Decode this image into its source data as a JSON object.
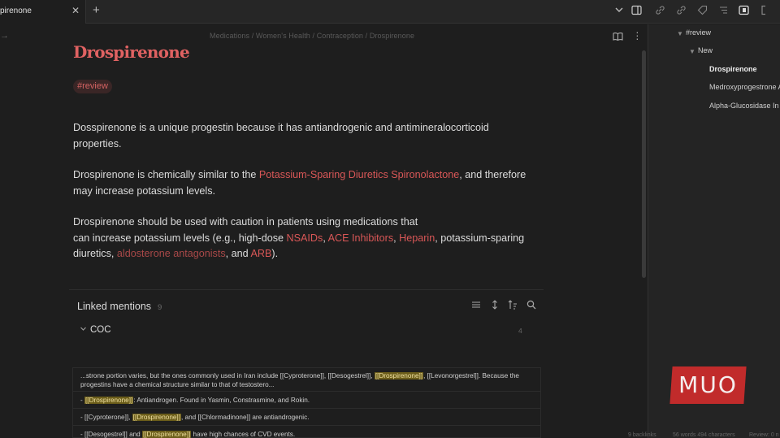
{
  "tab": {
    "title": "pirenone",
    "close": "✕",
    "new": "+"
  },
  "toolbar_icons": [
    "chevron-down-icon",
    "sidebar-toggle-icon",
    "link-icon",
    "link-icon",
    "tag-icon",
    "list-icon",
    "layout-icon",
    "bracket-icon"
  ],
  "breadcrumb": "Medications / Women's Health / Contraception / Drospirenone",
  "note": {
    "title": "Drospirenone",
    "tag": "#review",
    "p1": "Dosspirenone is a unique progestin because it has antiandrogenic and antimineralocorticoid properties.",
    "p2_start": "Drospirenone is chemically similar to the ",
    "p2_link": "Potassium-Sparing Diuretics Spironolactone",
    "p2_end": ", and therefore may increase potassium levels.",
    "p3_line1": "Drospirenone should be used with caution in patients using medications that",
    "p3_a": "can increase potassium levels (e.g., high-dose ",
    "p3_l1": "NSAIDs",
    "p3_c1": ", ",
    "p3_l2": "ACE Inhibitors",
    "p3_c2": ", ",
    "p3_l3": "Heparin",
    "p3_b": ", potassium-sparing",
    "p3_c": "diuretics, ",
    "p3_l4": "aldosterone antagonists",
    "p3_d": ", and ",
    "p3_l5": "ARB",
    "p3_e": ")."
  },
  "linked_mentions": {
    "title": "Linked mentions",
    "count": "9",
    "group_label": "COC",
    "group_count": "4",
    "snippets": [
      {
        "a": "...strone portion varies, but the ones commonly used in Iran include [[Cyproterone]], [[Desogestrel]], ",
        "hl": "[[Drospirenone]]",
        "b": ", [[Levonorgestrel]]. Because the progestins have a chemical structure similar to that of testostero..."
      },
      {
        "a": "- ",
        "hl": "[[Drospirenone]]",
        "b": ": Antiandrogen. Found in Yasmin, Constrasmine, and Rokin."
      },
      {
        "a": "- [[Cyproterone]], ",
        "hl": "[[Drospirenone]]",
        "b": ", and [[Chlormadinone]] are antiandrogenic."
      },
      {
        "a": "- [[Desogestrel]] and ",
        "hl": "[[Drospirenone]]",
        "b": " have high chances of CVD events."
      }
    ]
  },
  "sidebar": {
    "root": "#review",
    "group": "New",
    "items": [
      "Drospirenone",
      "Medroxyprogestrone A",
      "Alpha-Glucosidase In"
    ]
  },
  "logo": "MUO",
  "status": {
    "backlinks": "9 backlinks",
    "words": "56 words 494 characters",
    "review": "Review: 0 n"
  },
  "colors": {
    "accent": "#e06262",
    "highlight": "#6b5d1a",
    "logo_bg": "#c12b2b"
  }
}
